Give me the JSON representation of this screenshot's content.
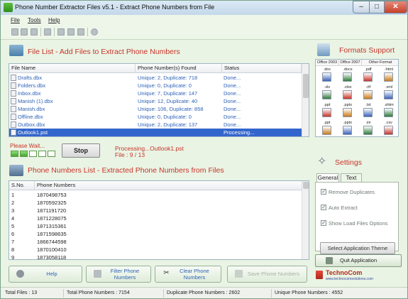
{
  "window": {
    "title": "Phone Number Extractor Files v5.1 - Extract Phone Numbers from File",
    "minimize_glyph": "–",
    "maximize_glyph": "□",
    "close_glyph": "✕"
  },
  "menu": [
    "File",
    "Tools",
    "Help"
  ],
  "toolbar_icons": [
    "new-icon",
    "open-icon",
    "save-icon",
    "export-icon",
    "cut-icon",
    "filter-icon",
    "key-icon",
    "search-icon"
  ],
  "file_list": {
    "title": "File List - Add Files to Extract Phone Numbers",
    "columns": [
      "File Name",
      "Phone Number(s) Found",
      "Status"
    ],
    "rows": [
      {
        "name": "Drafts.dbx",
        "found": "Unique: 2, Duplicate: 718",
        "status": "Done...",
        "selected": false
      },
      {
        "name": "Folders.dbx",
        "found": "Unique: 0, Duplicate: 0",
        "status": "Done...",
        "selected": false
      },
      {
        "name": "Inbox.dbx",
        "found": "Unique: 7, Duplicate: 147",
        "status": "Done...",
        "selected": false
      },
      {
        "name": "Manish (1).dbx",
        "found": "Unique: 12, Duplicate: 40",
        "status": "Done...",
        "selected": false
      },
      {
        "name": "Manish.dbx",
        "found": "Unique: 106, Duplicate: 858",
        "status": "Done...",
        "selected": false
      },
      {
        "name": "Offline.dbx",
        "found": "Unique: 0, Duplicate: 0",
        "status": "Done...",
        "selected": false
      },
      {
        "name": "Outbox.dbx",
        "found": "Unique: 2, Duplicate: 137",
        "status": "Done...",
        "selected": false
      },
      {
        "name": "Outlook1.pst",
        "found": "",
        "status": "Processing...",
        "selected": true
      }
    ]
  },
  "progress": {
    "label": "Please Wait...",
    "blocks_total": 5,
    "blocks_done": 2,
    "stop_label": "Stop",
    "processing_text": "Processing...Outlook1.pst",
    "file_count_text": "File : 9 / 13"
  },
  "numbers_list": {
    "title": "Phone Numbers List - Extracted Phone Numbers from Files",
    "columns": [
      "S.No.",
      "Phone Numbers"
    ],
    "rows": [
      [
        "1",
        "1870498753"
      ],
      [
        "2",
        "1870592325"
      ],
      [
        "3",
        "1871191720"
      ],
      [
        "4",
        "1871228075"
      ],
      [
        "5",
        "1871315361"
      ],
      [
        "6",
        "1871598635"
      ],
      [
        "7",
        "1866744598"
      ],
      [
        "8",
        "1870100410"
      ],
      [
        "9",
        "1873058118"
      ]
    ]
  },
  "formats": {
    "title": "Formats Support",
    "headers": [
      "Office 2003",
      "Office 2007",
      "Other Format"
    ],
    "items": [
      [
        ".doc",
        ".docx",
        ".pdf",
        ".html"
      ],
      [
        ".xls",
        ".xlsx",
        ".rtf",
        ".xml"
      ],
      [
        ".ppt",
        ".pptx",
        ".txt",
        ".shtm"
      ],
      [
        ".ppt",
        ".pptx",
        ".ini",
        ".csv"
      ]
    ]
  },
  "settings": {
    "title": "Settings",
    "tabs": [
      "General",
      "Text"
    ],
    "active_tab": "General",
    "options": [
      {
        "label": "Remove Duplicates",
        "checked": true
      },
      {
        "label": "Auto Extract",
        "checked": true
      },
      {
        "label": "Show Load Files Options",
        "checked": true
      }
    ],
    "theme_button": "Select Application Theme"
  },
  "quit_label": "Quit Application",
  "buttons": {
    "help": "Help",
    "filter": "Filter Phone Numbers",
    "clear": "Clear Phone Numbers",
    "save": "Save Phone Numbers"
  },
  "logo": {
    "name": "TechnoCom",
    "url_text": "www.technocomsolutions.com"
  },
  "status_bar": {
    "total_files": "Total Files :  13",
    "total_numbers": "Total Phone Numbers :   7154",
    "duplicate_numbers": "Duplicate Phone Numbers :   2602",
    "unique_numbers": "Unique Phone Numbers :    4552"
  },
  "colors": {
    "accent_red": "#c8342a",
    "link_blue": "#2f62b7",
    "selection": "#3366cc",
    "window_bg": "#e9f4e4"
  }
}
